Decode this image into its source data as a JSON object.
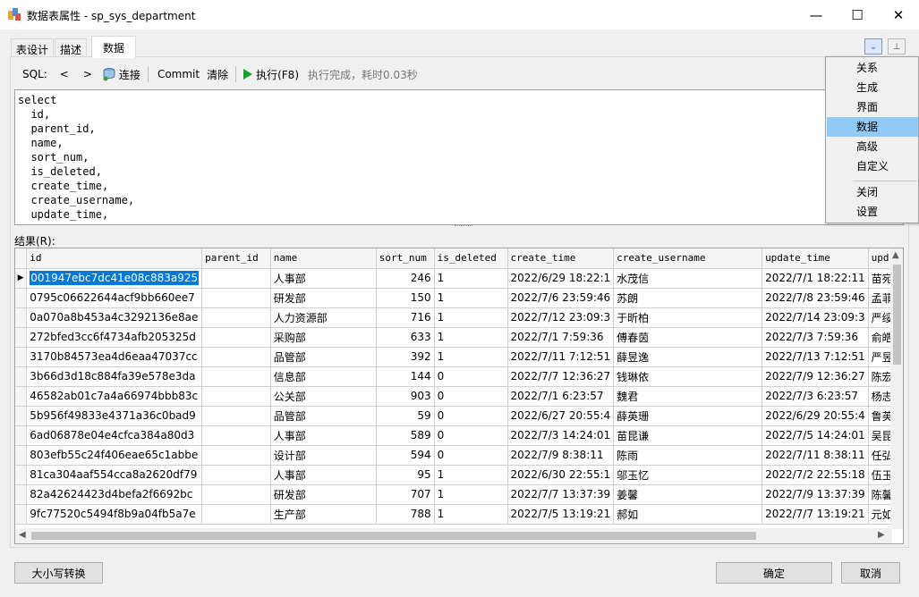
{
  "window": {
    "title": "数据表属性 - sp_sys_department",
    "minimize_glyph": "—",
    "maximize_glyph": "☐",
    "close_glyph": "✕"
  },
  "tabs": [
    {
      "label": "表设计"
    },
    {
      "label": "描述"
    },
    {
      "label": "数据"
    }
  ],
  "corner_buttons": {
    "dropdown_glyph": "⌄",
    "pin_glyph": "⊥"
  },
  "toolbar": {
    "sql_label": "SQL:",
    "prev_glyph": "<",
    "next_glyph": ">",
    "connect_label": "连接",
    "commit_label": "Commit",
    "clear_label": "清除",
    "execute_label": "执行(F8)",
    "status": "执行完成，耗时0.03秒"
  },
  "editor": {
    "sql": "select\n  id,\n  parent_id,\n  name,\n  sort_num,\n  is_deleted,\n  create_time,\n  create_username,\n  update_time,"
  },
  "results_label": "结果(R):",
  "grid": {
    "columns": [
      "id",
      "parent_id",
      "name",
      "sort_num",
      "is_deleted",
      "create_time",
      "create_username",
      "update_time",
      "upd"
    ],
    "rows": [
      [
        "001947ebc7dc41e08c883a925",
        "",
        "人事部",
        "246",
        "1",
        "2022/6/29 18:22:1",
        "水茂信",
        "2022/7/1 18:22:11",
        "苗宛"
      ],
      [
        "0795c06622644acf9bb660ee7",
        "",
        "研发部",
        "150",
        "1",
        "2022/7/6 23:59:46",
        "苏朗",
        "2022/7/8 23:59:46",
        "孟菲"
      ],
      [
        "0a070a8b453a4c3292136e8ae",
        "",
        "人力资源部",
        "716",
        "1",
        "2022/7/12 23:09:3",
        "于昕柏",
        "2022/7/14 23:09:3",
        "严绥"
      ],
      [
        "272bfed3cc6f4734afb205325d",
        "",
        "采购部",
        "633",
        "1",
        "2022/7/1 7:59:36",
        "傅春茵",
        "2022/7/3 7:59:36",
        "俞皓"
      ],
      [
        "3170b84573ea4d6eaa47037cc",
        "",
        "品管部",
        "392",
        "1",
        "2022/7/11 7:12:51",
        "薛昱逸",
        "2022/7/13 7:12:51",
        "严昱"
      ],
      [
        "3b66d3d18c884fa39e578e3da",
        "",
        "信息部",
        "144",
        "0",
        "2022/7/7 12:36:27",
        "钱琳依",
        "2022/7/9 12:36:27",
        "陈宏"
      ],
      [
        "46582ab01c7a4a66974bbb83c",
        "",
        "公关部",
        "903",
        "0",
        "2022/7/1 6:23:57",
        "魏君",
        "2022/7/3 6:23:57",
        "杨志"
      ],
      [
        "5b956f49833e4371a36c0bad9",
        "",
        "品管部",
        "59",
        "0",
        "2022/6/27 20:55:4",
        "薛英珊",
        "2022/6/29 20:55:4",
        "鲁英"
      ],
      [
        "6ad06878e04e4cfca384a80d3",
        "",
        "人事部",
        "589",
        "0",
        "2022/7/3 14:24:01",
        "苗昆谦",
        "2022/7/5 14:24:01",
        "吴昆"
      ],
      [
        "803efb55c24f406eae65c1abbe",
        "",
        "设计部",
        "594",
        "0",
        "2022/7/9 8:38:11",
        "陈雨",
        "2022/7/11 8:38:11",
        "任弘"
      ],
      [
        "81ca304aaf554cca8a2620df79",
        "",
        "人事部",
        "95",
        "1",
        "2022/6/30 22:55:1",
        "邬玉忆",
        "2022/7/2 22:55:18",
        "伍玉"
      ],
      [
        "82a42624423d4befa2f6692bc",
        "",
        "研发部",
        "707",
        "1",
        "2022/7/7 13:37:39",
        "姜馨",
        "2022/7/9 13:37:39",
        "陈馨"
      ],
      [
        "9fc77520c5494f8b9a04fb5a7e",
        "",
        "生产部",
        "788",
        "1",
        "2022/7/5 13:19:21",
        "郝如",
        "2022/7/7 13:19:21",
        "元如"
      ]
    ],
    "current_row_marker": "▶"
  },
  "footer": {
    "case_convert_label": "大小写转换",
    "ok_label": "确定",
    "cancel_label": "取消"
  },
  "menu": {
    "items": [
      "关系",
      "生成",
      "界面",
      "数据",
      "高级",
      "自定义",
      "关闭",
      "设置"
    ],
    "active_index": 3
  },
  "colors": {
    "selection": "#0078d7",
    "menu_highlight": "#91c9f7",
    "execute_green": "#1a9e2a"
  }
}
